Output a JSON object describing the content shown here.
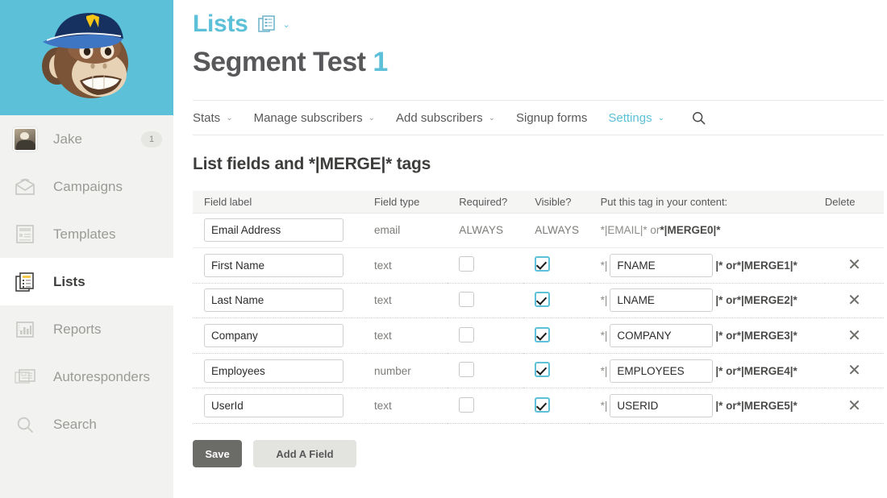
{
  "sidebar": {
    "logo": "freddie-mailchimp-logo",
    "user": {
      "name": "Jake",
      "badge": "1",
      "icon": "avatar"
    },
    "items": [
      {
        "label": "Campaigns",
        "icon": "envelope-icon",
        "active": false
      },
      {
        "label": "Templates",
        "icon": "document-icon",
        "active": false
      },
      {
        "label": "Lists",
        "icon": "lists-icon",
        "active": true
      },
      {
        "label": "Reports",
        "icon": "bar-chart-icon",
        "active": false
      },
      {
        "label": "Autoresponders",
        "icon": "autoresponder-icon",
        "active": false
      },
      {
        "label": "Search",
        "icon": "search-icon",
        "active": false
      }
    ]
  },
  "header": {
    "breadcrumb": "Lists",
    "breadcrumb_icon": "lists-stack-icon",
    "breadcrumb_caret": "⌄",
    "title_main": "Segment Test",
    "title_accent": "1"
  },
  "tabs": [
    {
      "label": "Stats",
      "caret": "⌄",
      "active": false
    },
    {
      "label": "Manage subscribers",
      "caret": "⌄",
      "active": false
    },
    {
      "label": "Add subscribers",
      "caret": "⌄",
      "active": false
    },
    {
      "label": "Signup forms",
      "caret": "",
      "active": false
    },
    {
      "label": "Settings",
      "caret": "⌄",
      "active": true
    }
  ],
  "tab_search_icon": "search-icon",
  "section": {
    "title": "List fields and *|MERGE|* tags"
  },
  "table": {
    "columns": [
      "Field label",
      "Field type",
      "Required?",
      "Visible?",
      "Put this tag in your content:",
      "Delete"
    ],
    "rows": [
      {
        "field_label": "Email Address",
        "field_type": "email",
        "required_mode": "always",
        "required_text": "ALWAYS",
        "required_checked": false,
        "visible_mode": "always",
        "visible_text": "ALWAYS",
        "visible_checked": false,
        "tag_mode": "static",
        "tag_static_plain": "*|EMAIL|* or ",
        "tag_static_bold": "*|MERGE0|*",
        "tag_value": "",
        "tag_suffix_plain": "",
        "tag_suffix_bold": "",
        "deletable": false,
        "delete_icon": ""
      },
      {
        "field_label": "First Name",
        "field_type": "text",
        "required_mode": "checkbox",
        "required_text": "",
        "required_checked": false,
        "visible_mode": "checkbox",
        "visible_text": "",
        "visible_checked": true,
        "tag_mode": "input",
        "tag_static_plain": "",
        "tag_static_bold": "",
        "tag_prefix": "*|",
        "tag_value": "FNAME",
        "tag_suffix_plain": "|* or ",
        "tag_suffix_bold": "*|MERGE1|*",
        "deletable": true,
        "delete_icon": "✕"
      },
      {
        "field_label": "Last Name",
        "field_type": "text",
        "required_mode": "checkbox",
        "required_text": "",
        "required_checked": false,
        "visible_mode": "checkbox",
        "visible_text": "",
        "visible_checked": true,
        "tag_mode": "input",
        "tag_static_plain": "",
        "tag_static_bold": "",
        "tag_prefix": "*|",
        "tag_value": "LNAME",
        "tag_suffix_plain": "|* or ",
        "tag_suffix_bold": "*|MERGE2|*",
        "deletable": true,
        "delete_icon": "✕"
      },
      {
        "field_label": "Company",
        "field_type": "text",
        "required_mode": "checkbox",
        "required_text": "",
        "required_checked": false,
        "visible_mode": "checkbox",
        "visible_text": "",
        "visible_checked": true,
        "tag_mode": "input",
        "tag_static_plain": "",
        "tag_static_bold": "",
        "tag_prefix": "*|",
        "tag_value": "COMPANY",
        "tag_suffix_plain": "|* or ",
        "tag_suffix_bold": "*|MERGE3|*",
        "deletable": true,
        "delete_icon": "✕"
      },
      {
        "field_label": "Employees",
        "field_type": "number",
        "required_mode": "checkbox",
        "required_text": "",
        "required_checked": false,
        "visible_mode": "checkbox",
        "visible_text": "",
        "visible_checked": true,
        "tag_mode": "input",
        "tag_static_plain": "",
        "tag_static_bold": "",
        "tag_prefix": "*|",
        "tag_value": "EMPLOYEES",
        "tag_suffix_plain": "|* or ",
        "tag_suffix_bold": "*|MERGE4|*",
        "deletable": true,
        "delete_icon": "✕"
      },
      {
        "field_label": "UserId",
        "field_type": "text",
        "required_mode": "checkbox",
        "required_text": "",
        "required_checked": false,
        "visible_mode": "checkbox",
        "visible_text": "",
        "visible_checked": true,
        "tag_mode": "input",
        "tag_static_plain": "",
        "tag_static_bold": "",
        "tag_prefix": "*|",
        "tag_value": "USERID",
        "tag_suffix_plain": "|* or ",
        "tag_suffix_bold": "*|MERGE5|*",
        "deletable": true,
        "delete_icon": "✕"
      }
    ]
  },
  "actions": {
    "save_label": "Save",
    "add_field_label": "Add A Field"
  },
  "colors": {
    "brand_teal": "#5bc0d8",
    "sidebar_bg": "#f2f2f0",
    "text_dark": "#3d3d3b",
    "text_muted": "#9a9a96",
    "save_button": "#6b6b68",
    "add_button": "#e3e3e0"
  }
}
